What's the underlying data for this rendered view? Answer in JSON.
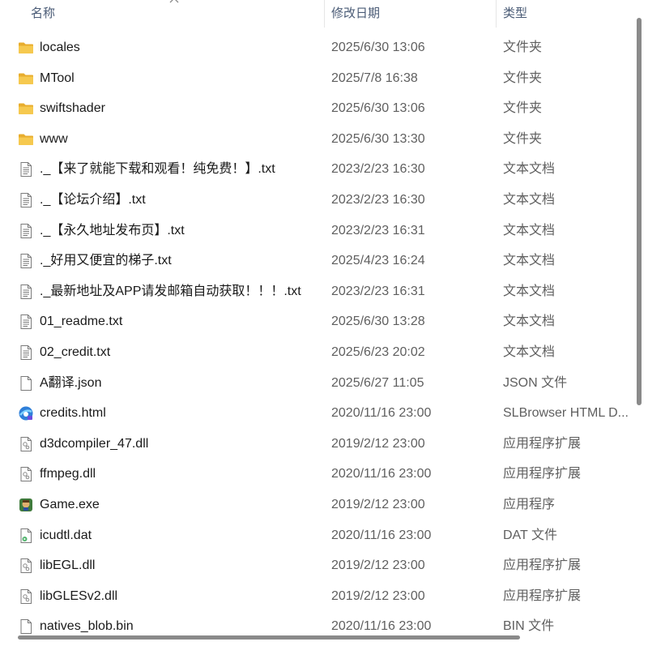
{
  "header": {
    "name": "名称",
    "date": "修改日期",
    "type": "类型"
  },
  "files": [
    {
      "name": "locales",
      "date": "2025/6/30 13:06",
      "type": "文件夹",
      "icon": "folder-icon"
    },
    {
      "name": "MTool",
      "date": "2025/7/8 16:38",
      "type": "文件夹",
      "icon": "folder-icon"
    },
    {
      "name": "swiftshader",
      "date": "2025/6/30 13:06",
      "type": "文件夹",
      "icon": "folder-icon"
    },
    {
      "name": "www",
      "date": "2025/6/30 13:30",
      "type": "文件夹",
      "icon": "folder-icon"
    },
    {
      "name": "._【来了就能下载和观看！纯免费！】.txt",
      "date": "2023/2/23 16:30",
      "type": "文本文档",
      "icon": "text-file-icon"
    },
    {
      "name": "._【论坛介绍】.txt",
      "date": "2023/2/23 16:30",
      "type": "文本文档",
      "icon": "text-file-icon"
    },
    {
      "name": "._【永久地址发布页】.txt",
      "date": "2023/2/23 16:31",
      "type": "文本文档",
      "icon": "text-file-icon"
    },
    {
      "name": "._好用又便宜的梯子.txt",
      "date": "2025/4/23 16:24",
      "type": "文本文档",
      "icon": "text-file-icon"
    },
    {
      "name": "._最新地址及APP请发邮箱自动获取！！！.txt",
      "date": "2023/2/23 16:31",
      "type": "文本文档",
      "icon": "text-file-icon"
    },
    {
      "name": "01_readme.txt",
      "date": "2025/6/30 13:28",
      "type": "文本文档",
      "icon": "text-file-icon"
    },
    {
      "name": "02_credit.txt",
      "date": "2025/6/23 20:02",
      "type": "文本文档",
      "icon": "text-file-icon"
    },
    {
      "name": "A翻译.json",
      "date": "2025/6/27 11:05",
      "type": "JSON 文件",
      "icon": "blank-file-icon"
    },
    {
      "name": "credits.html",
      "date": "2020/11/16 23:00",
      "type": "SLBrowser HTML D...",
      "icon": "browser-icon"
    },
    {
      "name": "d3dcompiler_47.dll",
      "date": "2019/2/12 23:00",
      "type": "应用程序扩展",
      "icon": "dll-file-icon"
    },
    {
      "name": "ffmpeg.dll",
      "date": "2020/11/16 23:00",
      "type": "应用程序扩展",
      "icon": "dll-file-icon"
    },
    {
      "name": "Game.exe",
      "date": "2019/2/12 23:00",
      "type": "应用程序",
      "icon": "game-exe-icon"
    },
    {
      "name": "icudtl.dat",
      "date": "2020/11/16 23:00",
      "type": "DAT 文件",
      "icon": "dat-file-icon"
    },
    {
      "name": "libEGL.dll",
      "date": "2019/2/12 23:00",
      "type": "应用程序扩展",
      "icon": "dll-file-icon"
    },
    {
      "name": "libGLESv2.dll",
      "date": "2019/2/12 23:00",
      "type": "应用程序扩展",
      "icon": "dll-file-icon"
    },
    {
      "name": "natives_blob.bin",
      "date": "2020/11/16 23:00",
      "type": "BIN 文件",
      "icon": "blank-file-icon"
    }
  ],
  "colors": {
    "folder": "#f4c24f",
    "header_text": "#4a5b76",
    "muted_text": "#5f5f5f",
    "scrollbar": "#8a8a8a"
  }
}
